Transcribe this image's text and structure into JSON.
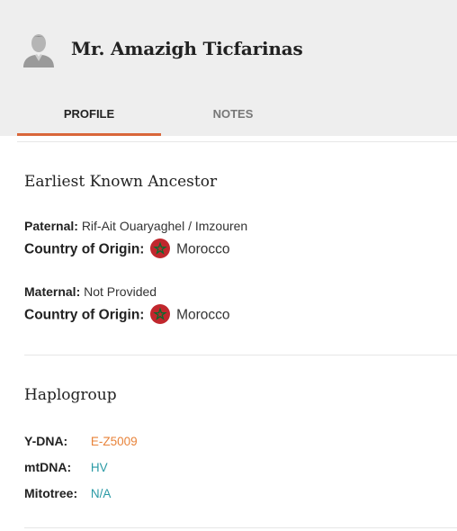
{
  "header": {
    "name": "Mr. Amazigh Ticfarinas",
    "avatar_icon": "user-avatar-icon"
  },
  "tabs": [
    {
      "label": "PROFILE",
      "active": true
    },
    {
      "label": "NOTES",
      "active": false
    }
  ],
  "accent_color": "#d9663a",
  "ancestor": {
    "title": "Earliest Known Ancestor",
    "paternal_label": "Paternal:",
    "paternal_value": "Rif-Ait Ouaryaghel / Imzouren",
    "paternal_country_label": "Country of Origin:",
    "paternal_country": "Morocco",
    "maternal_label": "Maternal:",
    "maternal_value": "Not Provided",
    "maternal_country_label": "Country of Origin:",
    "maternal_country": "Morocco",
    "flag_icon": "morocco-flag-icon"
  },
  "haplogroup": {
    "title": "Haplogroup",
    "ydna_label": "Y-DNA:",
    "ydna_value": "E-Z5009",
    "mtdna_label": "mtDNA:",
    "mtdna_value": "HV",
    "mitotree_label": "Mitotree:",
    "mitotree_value": "N/A",
    "ydna_color": "#e8833a",
    "link_color": "#2a9aa5"
  }
}
